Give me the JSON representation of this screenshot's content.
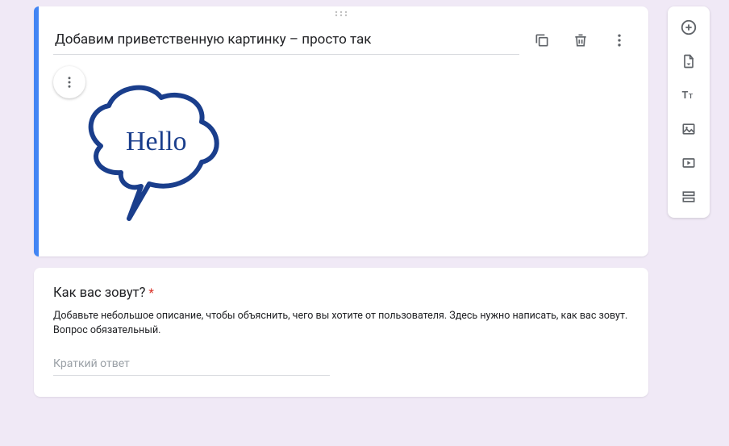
{
  "image_block": {
    "title": "Добавим приветственную картинку – просто так",
    "image_text": "Hello"
  },
  "question_block": {
    "title": "Как вас зовут?",
    "required_mark": "*",
    "description": "Добавьте небольшое описание, чтобы объяснить, чего вы хотите от пользователя. Здесь нужно написать, как вас зовут. Вопрос обязательный.",
    "answer_placeholder": "Краткий ответ"
  },
  "toolbar": {
    "add_question": "add-question",
    "import_questions": "import-questions",
    "add_title": "add-title",
    "add_image": "add-image",
    "add_video": "add-video",
    "add_section": "add-section"
  }
}
